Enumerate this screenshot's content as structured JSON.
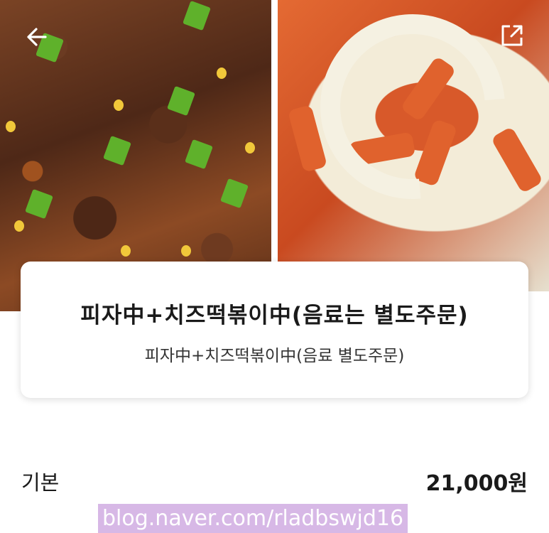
{
  "header": {
    "back_icon": "back-arrow-icon",
    "share_icon": "share-external-icon"
  },
  "product": {
    "title": "피자中+치즈떡볶이中(음료는 별도주문)",
    "subtitle": "피자中+치즈떡볶이中(음료 별도주문)"
  },
  "option": {
    "label": "기본",
    "price": "21,000원"
  },
  "watermark": {
    "text": "blog.naver.com/rladbswjd16"
  },
  "colors": {
    "watermark_bg": "#d7b8e6",
    "card_bg": "#ffffff",
    "text": "#1a1a1a"
  }
}
